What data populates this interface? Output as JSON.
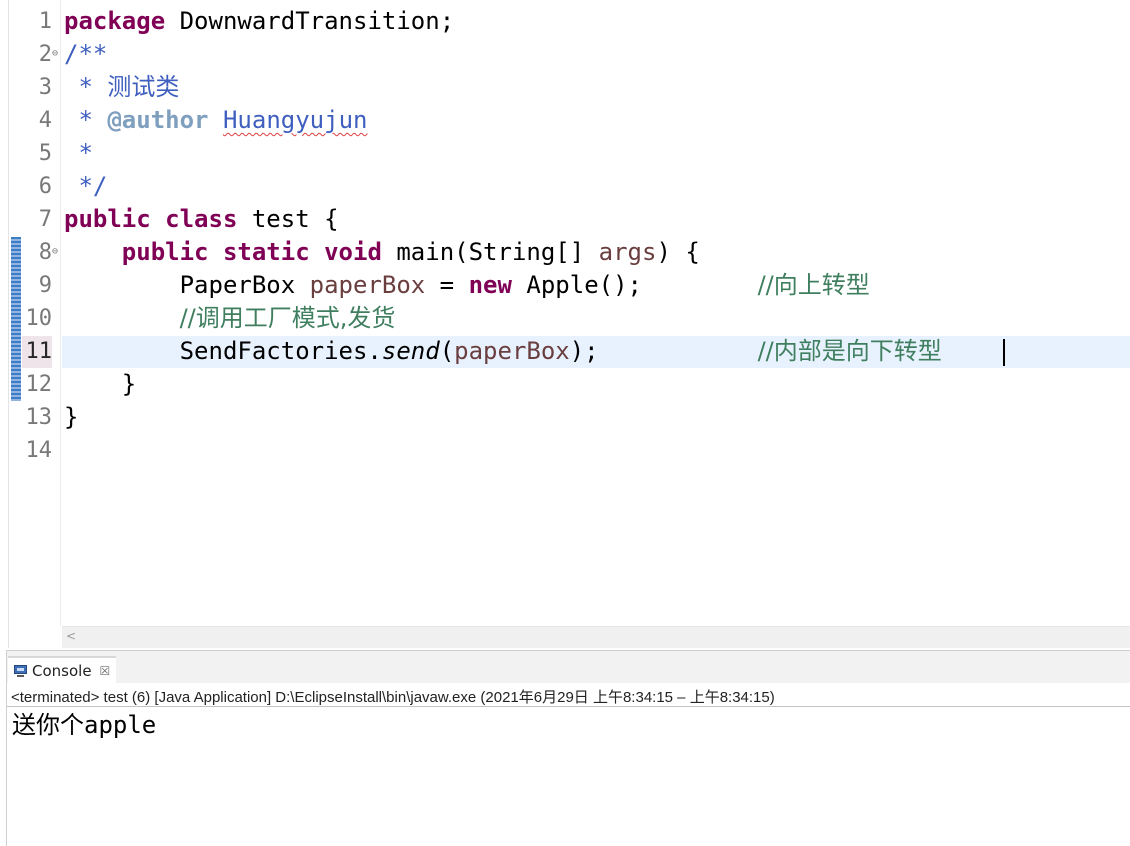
{
  "editor": {
    "line_numbers": [
      "1",
      "2",
      "3",
      "4",
      "5",
      "6",
      "7",
      "8",
      "9",
      "10",
      "11",
      "12",
      "13",
      "14"
    ],
    "lines": {
      "l1": {
        "kw": "package",
        "rest": " DownwardTransition;"
      },
      "l2": {
        "text": "/**"
      },
      "l3": {
        "star": " * ",
        "text": "测试类"
      },
      "l4": {
        "star": " * ",
        "tag": "@author",
        "sp": " ",
        "name": "Huangyujun"
      },
      "l5": {
        "text": " *"
      },
      "l6": {
        "text": " */"
      },
      "l7": {
        "kw1": "public",
        "sp1": " ",
        "kw2": "class",
        "rest": " test {"
      },
      "l8": {
        "indent": "    ",
        "kw1": "public",
        "sp1": " ",
        "kw2": "static",
        "sp2": " ",
        "kw3": "void",
        "rest1": " main(String[] ",
        "var": "args",
        "rest2": ") {"
      },
      "l9": {
        "indent": "        ",
        "type": "PaperBox",
        "sp1": " ",
        "var": "paperBox",
        "op": " = ",
        "kw": "new",
        "rest": " Apple();",
        "gap": "        ",
        "comment": "//向上转型"
      },
      "l10": {
        "indent": "        ",
        "comment": "//调用工厂模式,发货"
      },
      "l11": {
        "indent": "        ",
        "cls": "SendFactories.",
        "method": "send",
        "p1": "(",
        "var": "paperBox",
        "p2": ");",
        "gap": "           ",
        "comment": "//内部是向下转型"
      },
      "l12": {
        "text": "    }"
      },
      "l13": {
        "text": "}"
      },
      "l14": {
        "text": ""
      }
    }
  },
  "console": {
    "tab_label": "Console",
    "tab_close": "☒",
    "status": "<terminated> test (6) [Java Application] D:\\EclipseInstall\\bin\\javaw.exe  (2021年6月29日 上午8:34:15 – 上午8:34:15)",
    "output": "送你个apple"
  },
  "scrollbar": {
    "left_arrow": "<"
  }
}
